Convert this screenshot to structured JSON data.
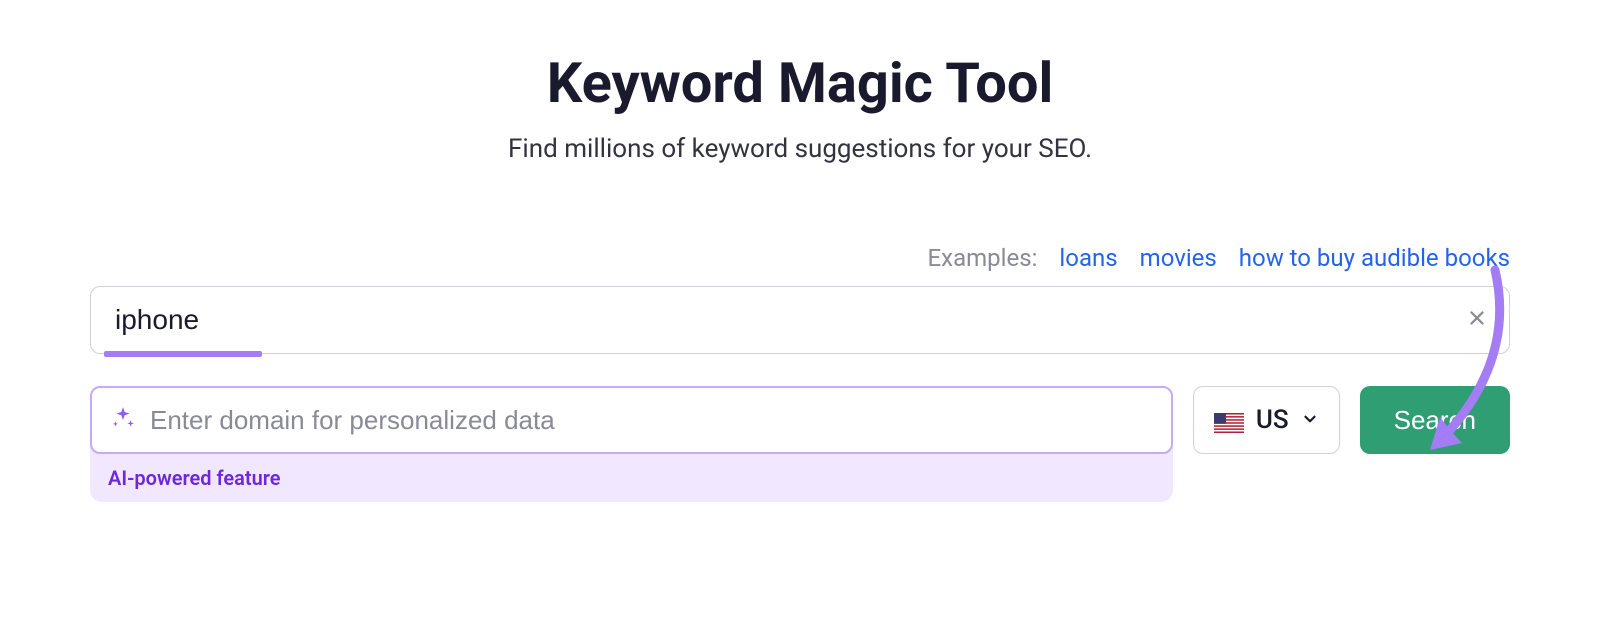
{
  "header": {
    "title": "Keyword Magic Tool",
    "subtitle": "Find millions of keyword suggestions for your SEO."
  },
  "examples": {
    "label": "Examples:",
    "links": [
      "loans",
      "movies",
      "how to buy audible books"
    ]
  },
  "search": {
    "value": "iphone"
  },
  "domain": {
    "placeholder": "Enter domain for personalized data",
    "ai_label": "AI-powered feature"
  },
  "country": {
    "code": "US"
  },
  "actions": {
    "search_label": "Search"
  }
}
